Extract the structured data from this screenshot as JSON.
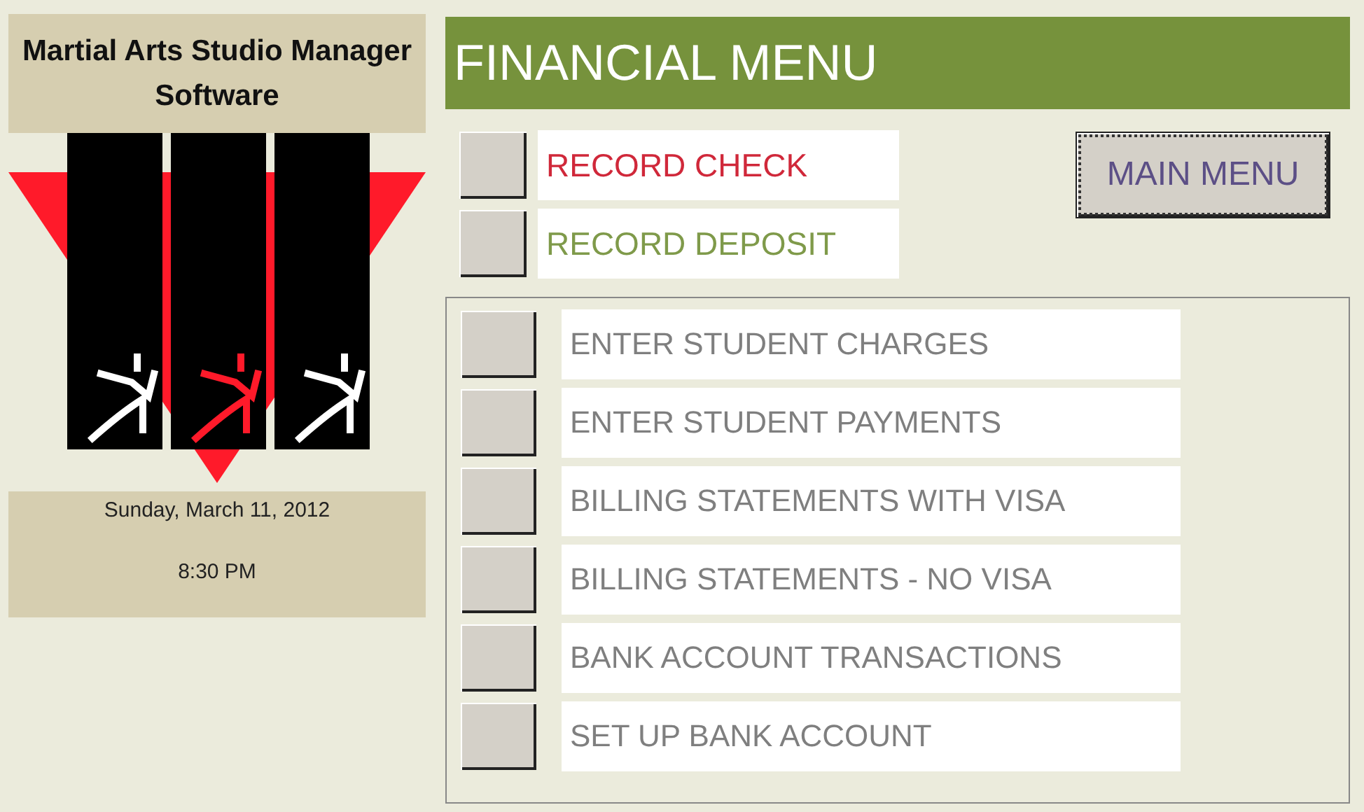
{
  "app_title": "Martial Arts Studio Manager Software",
  "date": "Sunday, March 11, 2012",
  "time": "8:30 PM",
  "header": "FINANCIAL MENU",
  "record_items": [
    {
      "label": "RECORD CHECK",
      "color": "#d0283a"
    },
    {
      "label": "RECORD DEPOSIT",
      "color": "#7f9a4a"
    }
  ],
  "main_menu_button": "MAIN MENU",
  "menu_items": [
    {
      "label": "ENTER STUDENT CHARGES"
    },
    {
      "label": "ENTER STUDENT PAYMENTS"
    },
    {
      "label": "BILLING STATEMENTS WITH VISA"
    },
    {
      "label": "BILLING STATEMENTS - NO VISA"
    },
    {
      "label": "BANK ACCOUNT TRANSACTIONS"
    },
    {
      "label": "SET UP BANK ACCOUNT"
    }
  ]
}
